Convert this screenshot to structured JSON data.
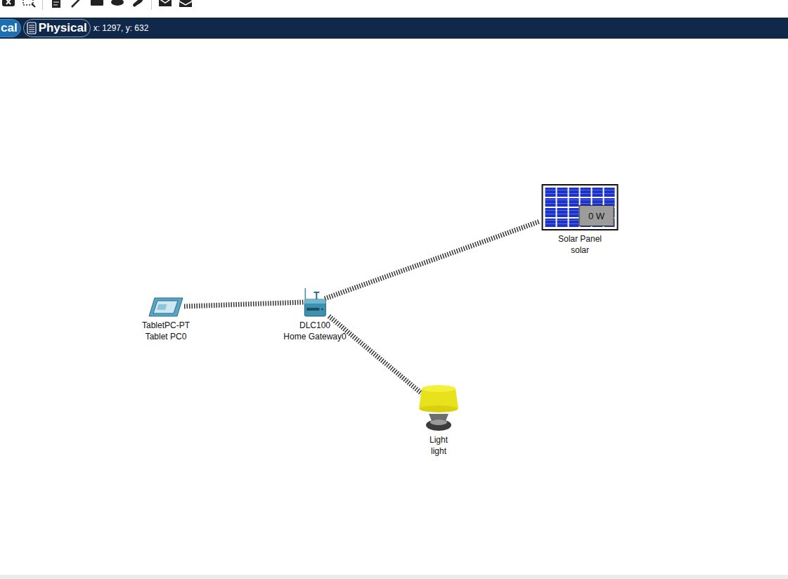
{
  "tabs": [
    {
      "label": "cal",
      "selected": true
    },
    {
      "label": "Physical",
      "selected": false
    }
  ],
  "cursor_position": "x: 1297, y: 632",
  "nodes": [
    {
      "kind": "tablet",
      "model": "TabletPC-PT",
      "name": "Tablet PC0"
    },
    {
      "kind": "gateway",
      "model": "DLC100",
      "name": "Home Gateway0"
    },
    {
      "kind": "solar",
      "model": "Solar Panel",
      "name": "solar",
      "reading": "0 W"
    },
    {
      "kind": "light",
      "model": "Light",
      "name": "light"
    }
  ],
  "links": [
    {
      "from": "Tablet PC0",
      "to": "Home Gateway0",
      "kind": "wireless"
    },
    {
      "from": "Home Gateway0",
      "to": "solar",
      "kind": "wireless"
    },
    {
      "from": "Home Gateway0",
      "to": "light",
      "kind": "wireless"
    }
  ]
}
